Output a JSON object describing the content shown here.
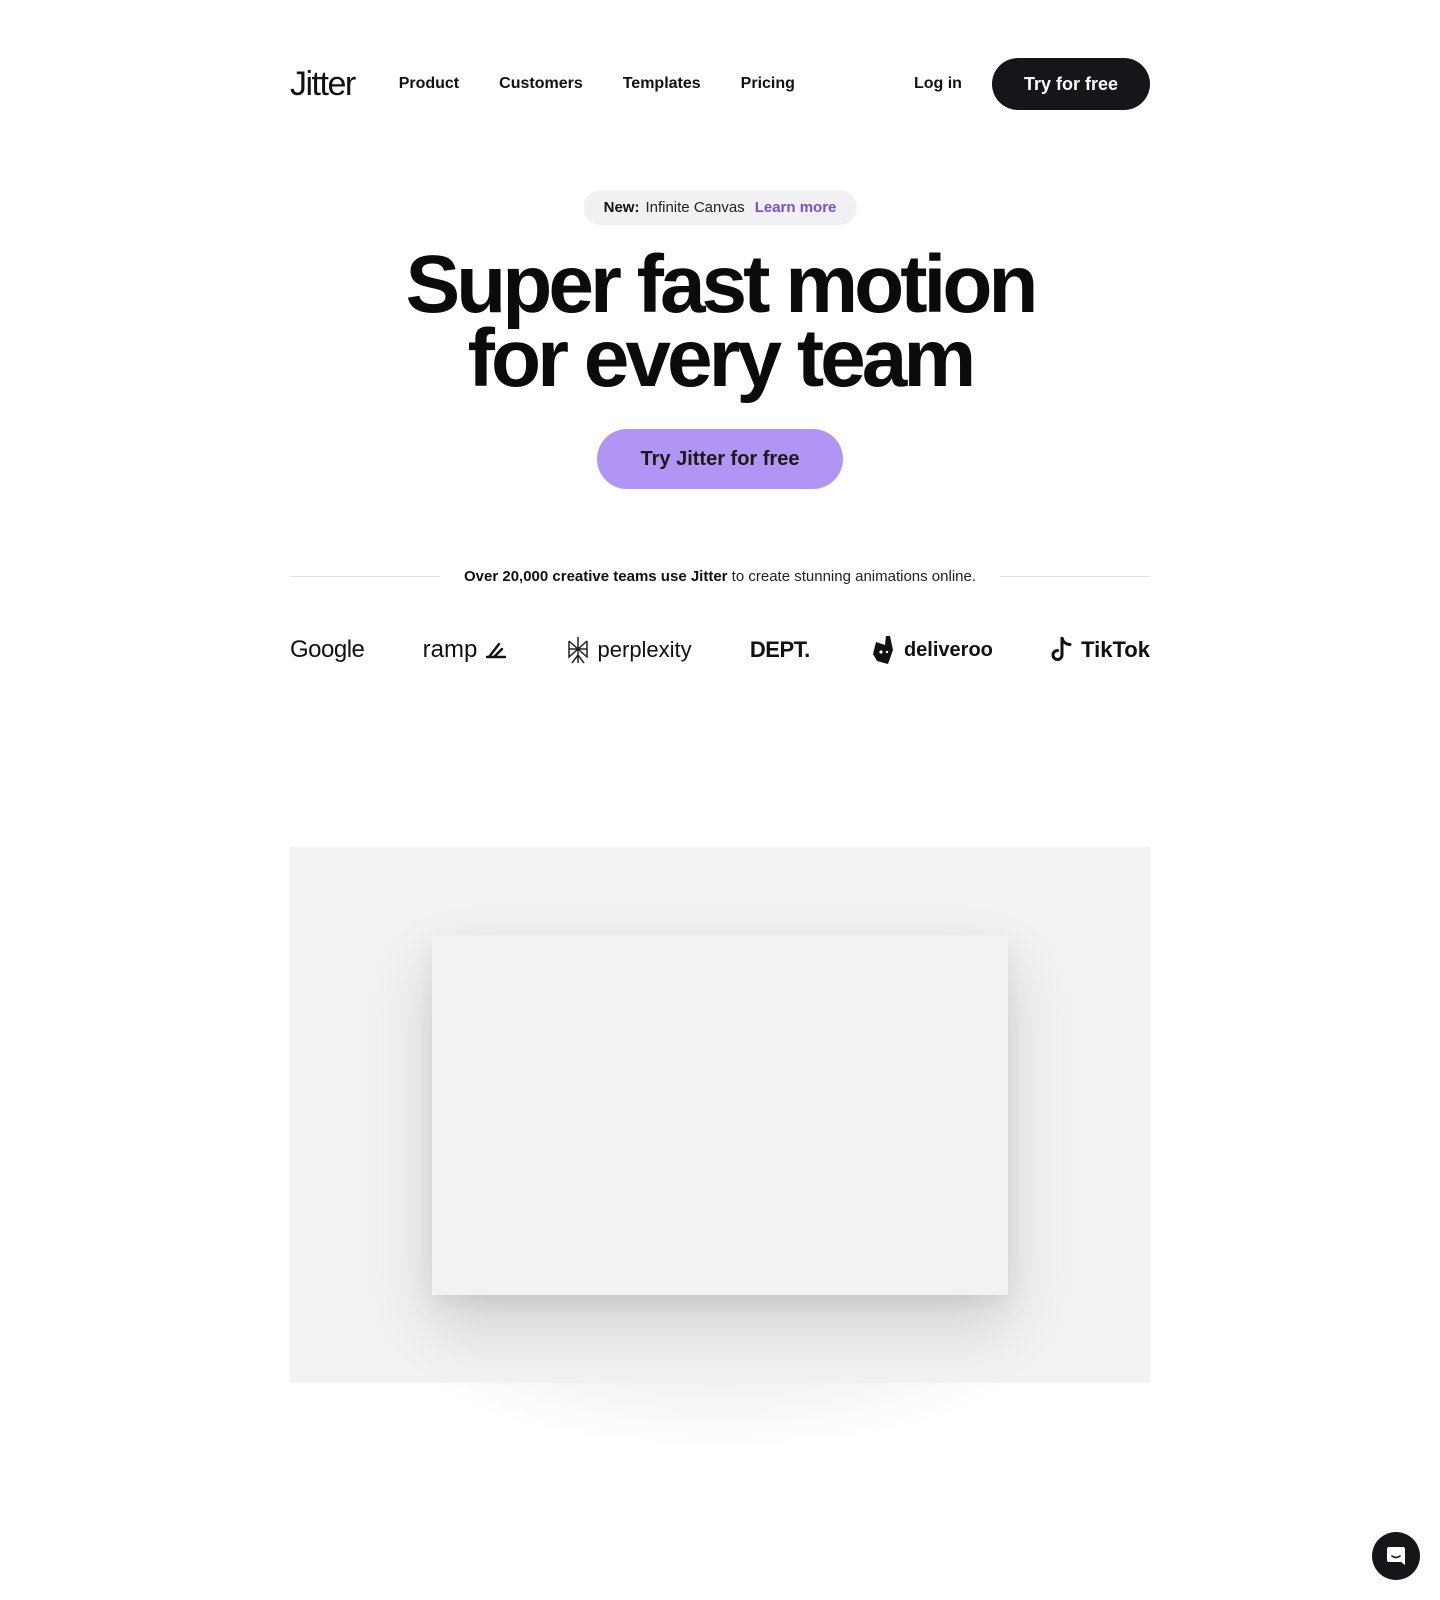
{
  "header": {
    "logo": "Jitter",
    "nav": [
      "Product",
      "Customers",
      "Templates",
      "Pricing"
    ],
    "login": "Log in",
    "cta": "Try for free"
  },
  "announcement": {
    "prefix": "New:",
    "text": "Infinite Canvas",
    "link": "Learn more"
  },
  "hero": {
    "line1": "Super fast motion",
    "line2": "for every team",
    "cta": "Try Jitter for free"
  },
  "social_proof": {
    "bold": "Over 20,000 creative teams use Jitter",
    "rest": " to create stunning animations online."
  },
  "logos": [
    "Google",
    "ramp",
    "perplexity",
    "DEPT.",
    "deliveroo",
    "TikTok"
  ],
  "colors": {
    "accent": "#b095f5",
    "link": "#7c4ddb",
    "dark": "#16161a",
    "panel": "#f2f2f4"
  },
  "icons": {
    "chat": "chat-bubble-icon"
  }
}
